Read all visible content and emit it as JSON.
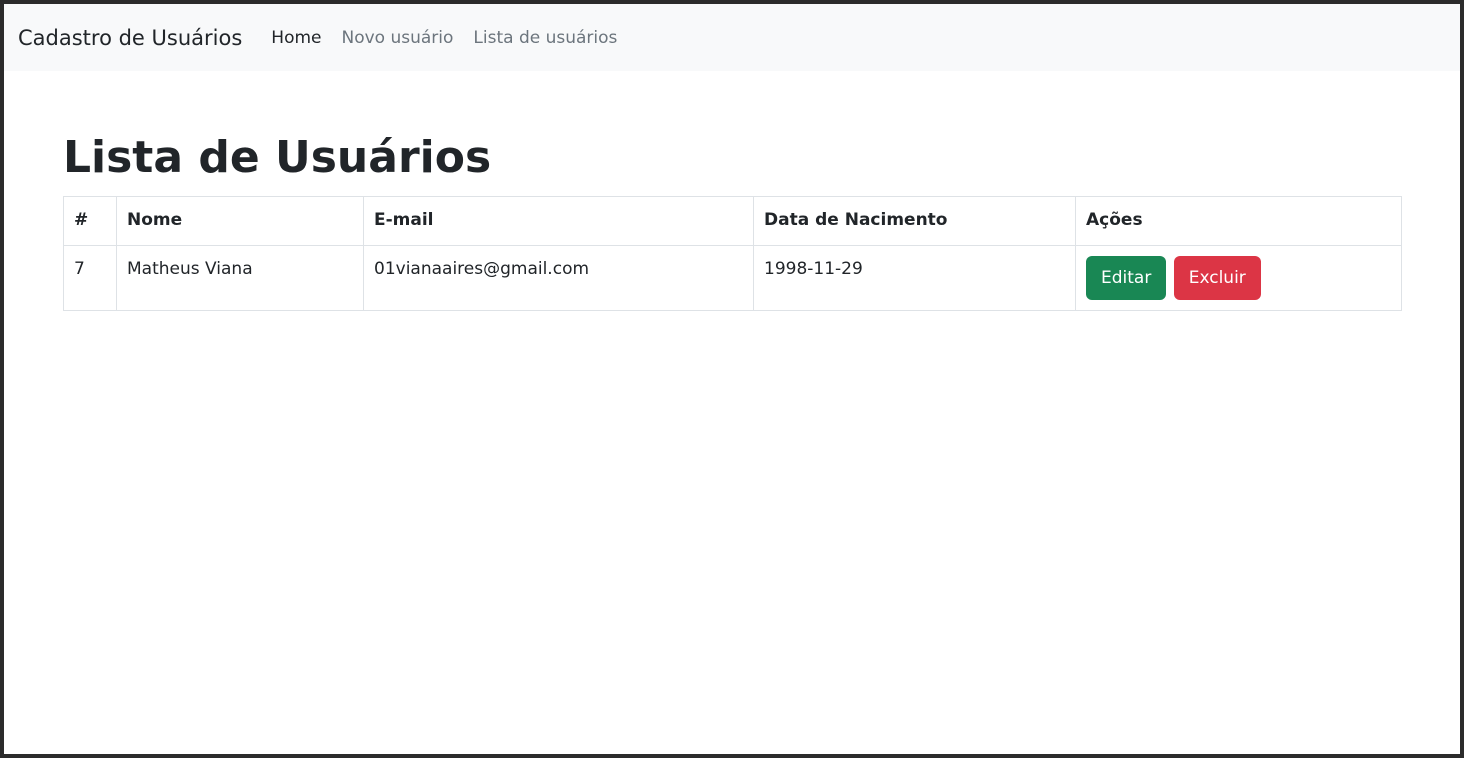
{
  "navbar": {
    "brand": "Cadastro de Usuários",
    "links": [
      {
        "label": "Home",
        "active": true
      },
      {
        "label": "Novo usuário",
        "active": false
      },
      {
        "label": "Lista de usuários",
        "active": false
      }
    ]
  },
  "page": {
    "title": "Lista de Usuários"
  },
  "table": {
    "headers": [
      "#",
      "Nome",
      "E-mail",
      "Data de Nacimento",
      "Ações"
    ],
    "rows": [
      {
        "id": "7",
        "nome": "Matheus Viana",
        "email": "01vianaaires@gmail.com",
        "data_nascimento": "1998-11-29",
        "actions": {
          "edit_label": "Editar",
          "delete_label": "Excluir"
        }
      }
    ]
  },
  "colors": {
    "navbar_bg": "#f8f9fa",
    "edit_button": "#198754",
    "delete_button": "#dc3545"
  }
}
